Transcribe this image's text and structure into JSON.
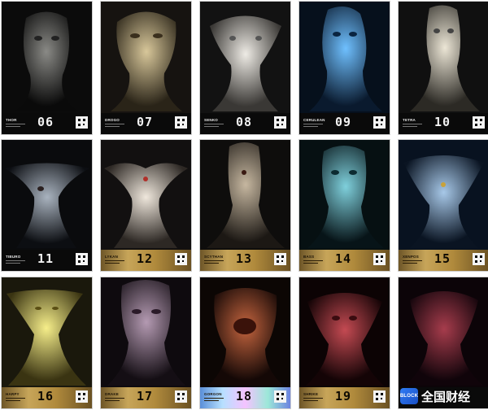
{
  "cards": [
    {
      "name": "THOR",
      "number": "06",
      "finish": "black"
    },
    {
      "name": "DROGO",
      "number": "07",
      "finish": "black"
    },
    {
      "name": "SENKO",
      "number": "08",
      "finish": "black"
    },
    {
      "name": "CERULEAN",
      "number": "09",
      "finish": "black"
    },
    {
      "name": "TETRA",
      "number": "10",
      "finish": "black"
    },
    {
      "name": "TIBURO",
      "number": "11",
      "finish": "black"
    },
    {
      "name": "LYKAN",
      "number": "12",
      "finish": "gold"
    },
    {
      "name": "SCYTHAN",
      "number": "13",
      "finish": "gold"
    },
    {
      "name": "BASS",
      "number": "14",
      "finish": "gold"
    },
    {
      "name": "XENPOS",
      "number": "15",
      "finish": "gold"
    },
    {
      "name": "HARPY",
      "number": "16",
      "finish": "gold"
    },
    {
      "name": "DRAKE",
      "number": "17",
      "finish": "gold"
    },
    {
      "name": "GORGON",
      "number": "18",
      "finish": "holo"
    },
    {
      "name": "SHRIKE",
      "number": "19",
      "finish": "gold"
    },
    {
      "name": "",
      "number": "",
      "finish": "black"
    }
  ],
  "palette": {
    "thor": "#6a6a66",
    "drogo": "#b9a57a",
    "senko": "#d8d5cf",
    "cerulean": "#3d8ed8",
    "tetra": "#d6d0c3",
    "tiburo": "#7d8793",
    "lykan": "#d9d1c6",
    "scythan": "#9a8b78",
    "bass": "#4aa5b4",
    "xenpos": "#4f78a6",
    "harpy": "#e8e06a",
    "drake": "#8a7088",
    "gorgon": "#8a3a24",
    "shrike": "#8a1e26",
    "last": "#6a2230"
  },
  "watermark": {
    "logo_text": "BLOCK",
    "text": "全国财经"
  }
}
